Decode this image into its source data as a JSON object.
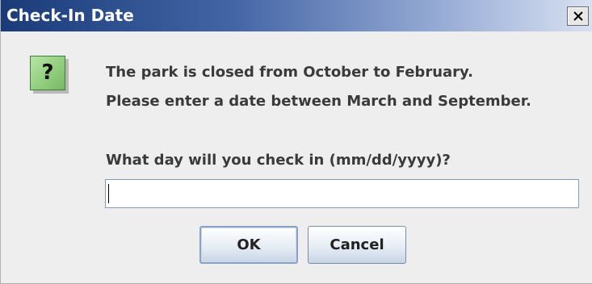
{
  "window": {
    "title": "Check-In Date",
    "close_icon": "close-icon"
  },
  "icon": {
    "name": "question-icon",
    "glyph": "?",
    "color": "#8fcc7b"
  },
  "message": {
    "line1": "The park is closed from October to February.",
    "line2": "Please enter a date between March and September.",
    "prompt": "What day will you check in (mm/dd/yyyy)?"
  },
  "input": {
    "value": "",
    "placeholder": ""
  },
  "buttons": {
    "ok": "OK",
    "cancel": "Cancel"
  },
  "colors": {
    "titlebar_start": "#1a3b78",
    "titlebar_end": "#d9e1f1",
    "dialog_bg": "#eeeeee"
  }
}
